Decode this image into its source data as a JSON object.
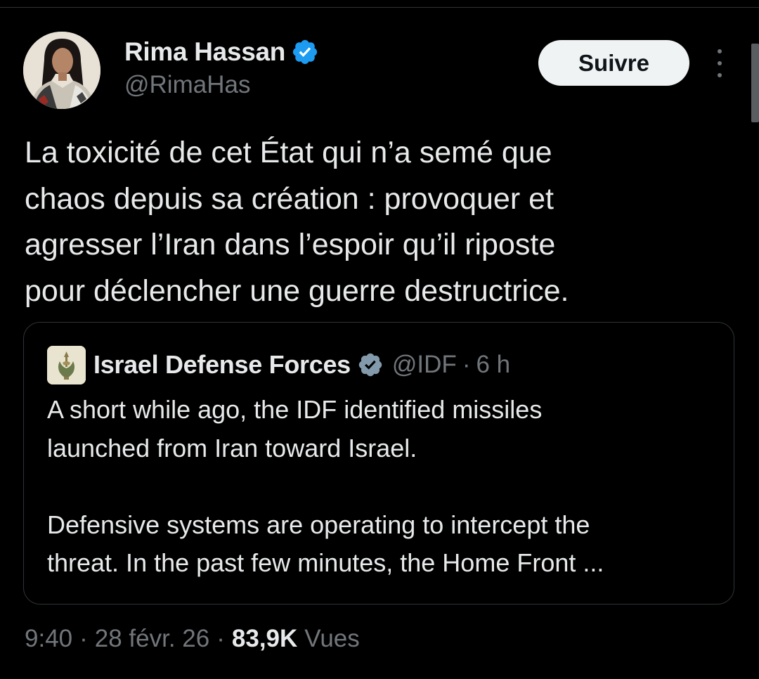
{
  "tweet": {
    "author": {
      "name": "Rima Hassan",
      "handle": "@RimaHas",
      "verified": true
    },
    "follow_label": "Suivre",
    "text": "La toxicité de cet État qui n’a semé que\nchaos depuis sa création : provoquer et\nagresser l’Iran dans l’espoir qu’il riposte\npour déclencher une guerre destructrice.",
    "time": "9:40",
    "date": "28 févr. 26",
    "views_count": "83,9K",
    "views_label": "Vues",
    "separator": "·"
  },
  "quote": {
    "author": {
      "name": "Israel Defense Forces",
      "handle": "@IDF",
      "verified": true
    },
    "separator": "·",
    "time": "6 h",
    "text": "A short while ago, the IDF identified missiles\nlaunched from Iran toward Israel.\n\nDefensive systems are operating to intercept the\nthreat. In the past few minutes, the Home Front ..."
  },
  "colors": {
    "background": "#000000",
    "text_primary": "#e7e9ea",
    "text_secondary": "#71767b",
    "verified_blue": "#1d9bf0",
    "verified_gray": "#829aab",
    "border": "#2f3336",
    "follow_button_bg": "#eff3f4"
  },
  "icons": {
    "verified_badge": "verified-badge-icon",
    "org_badge": "verified-org-badge-icon",
    "more": "more-options-icon"
  }
}
